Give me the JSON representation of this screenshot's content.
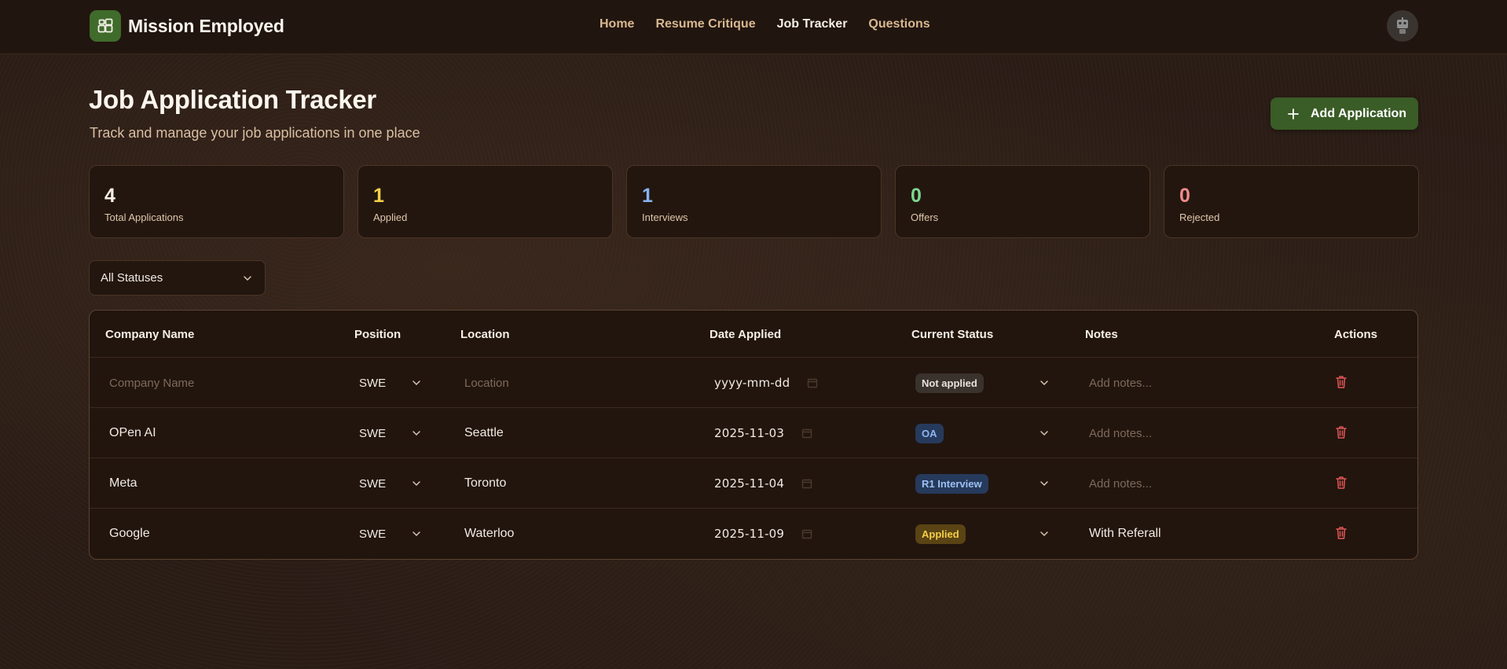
{
  "brand": {
    "name": "Mission Employed"
  },
  "nav": {
    "items": [
      {
        "label": "Home",
        "active": false
      },
      {
        "label": "Resume Critique",
        "active": false
      },
      {
        "label": "Job Tracker",
        "active": true
      },
      {
        "label": "Questions",
        "active": false
      }
    ]
  },
  "header": {
    "title": "Job Application Tracker",
    "subtitle": "Track and manage your job applications in one place",
    "add_button": "Add Application"
  },
  "stats": [
    {
      "value": "4",
      "label": "Total Applications",
      "color": "#f6efe6"
    },
    {
      "value": "1",
      "label": "Applied",
      "color": "#f4d24a"
    },
    {
      "value": "1",
      "label": "Interviews",
      "color": "#86b4ee"
    },
    {
      "value": "0",
      "label": "Offers",
      "color": "#7bd88f"
    },
    {
      "value": "0",
      "label": "Rejected",
      "color": "#f08a8a"
    }
  ],
  "filter": {
    "selected": "All Statuses"
  },
  "table": {
    "headers": [
      "Company Name",
      "Position",
      "Location",
      "Date Applied",
      "Current Status",
      "Notes",
      "Actions"
    ],
    "rows": [
      {
        "company": "",
        "company_placeholder": "Company Name",
        "position": "SWE",
        "location": "",
        "location_placeholder": "Location",
        "date": "yyyy-mm-dd",
        "status": "Not applied",
        "notes": "",
        "notes_placeholder": "Add notes..."
      },
      {
        "company": "OPen AI",
        "position": "SWE",
        "location": "Seattle",
        "date": "2025-11-03",
        "status": "OA",
        "notes": "",
        "notes_placeholder": "Add notes..."
      },
      {
        "company": "Meta",
        "position": "SWE",
        "location": "Toronto",
        "date": "2025-11-04",
        "status": "R1 Interview",
        "notes": "",
        "notes_placeholder": "Add notes..."
      },
      {
        "company": "Google",
        "position": "SWE",
        "location": "Waterloo",
        "date": "2025-11-09",
        "status": "Applied",
        "notes": "With Referall",
        "notes_placeholder": "Add notes..."
      }
    ]
  },
  "status_colors": {
    "Not applied": {
      "bg": "#3a322d",
      "fg": "#e8e1da"
    },
    "OA": {
      "bg": "#263a5c",
      "fg": "#8fb5ee"
    },
    "R1 Interview": {
      "bg": "#263a5c",
      "fg": "#9dc0f2"
    },
    "Applied": {
      "bg": "#5a4314",
      "fg": "#f4cf47"
    }
  },
  "icons": {
    "logo": "dashboard-icon",
    "avatar": "robot-icon",
    "add": "plus-icon",
    "chevron": "chevron-down-icon",
    "calendar": "calendar-icon",
    "delete": "trash-icon"
  }
}
